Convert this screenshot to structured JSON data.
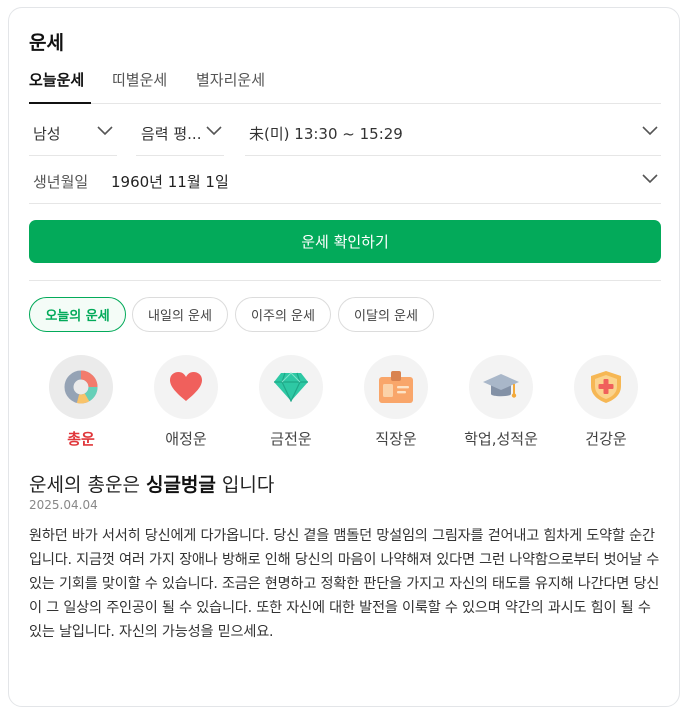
{
  "title": "운세",
  "tabs": [
    {
      "label": "오늘운세",
      "active": true
    },
    {
      "label": "띠별운세",
      "active": false
    },
    {
      "label": "별자리운세",
      "active": false
    }
  ],
  "form": {
    "gender": "남성",
    "calendar": "음력 평...",
    "birth_time": "未(미) 13:30 ~ 15:29",
    "birthdate_label": "생년월일",
    "birthdate_value": "1960년 11월 1일"
  },
  "confirm_button": "운세 확인하기",
  "period_chips": [
    {
      "label": "오늘의 운세",
      "active": true
    },
    {
      "label": "내일의 운세",
      "active": false
    },
    {
      "label": "이주의 운세",
      "active": false
    },
    {
      "label": "이달의 운세",
      "active": false
    }
  ],
  "categories": [
    {
      "label": "총운",
      "icon": "donut-chart-icon",
      "active": true
    },
    {
      "label": "애정운",
      "icon": "heart-icon",
      "active": false
    },
    {
      "label": "금전운",
      "icon": "diamond-icon",
      "active": false
    },
    {
      "label": "직장운",
      "icon": "id-badge-icon",
      "active": false
    },
    {
      "label": "학업,성적운",
      "icon": "graduation-cap-icon",
      "active": false
    },
    {
      "label": "건강운",
      "icon": "health-shield-icon",
      "active": false
    }
  ],
  "result": {
    "prefix": "운세의 총운은 ",
    "keyword": "싱글벙글",
    "suffix": " 입니다",
    "date": "2025.04.04",
    "body": "원하던 바가 서서히 당신에게 다가옵니다. 당신 곁을 맴돌던 망설임의 그림자를 걷어내고 힘차게 도약할 순간입니다. 지금껏 여러 가지 장애나 방해로 인해 당신의 마음이 나약해져 있다면 그런 나약함으로부터 벗어날 수 있는 기회를 맞이할 수 있습니다. 조금은 현명하고 정확한 판단을 가지고 자신의 태도를 유지해 나간다면 당신이 그 일상의 주인공이 될 수 있습니다. 또한 자신에 대한 발전을 이룩할 수 있으며 약간의 과시도 힘이 될 수 있는 날입니다. 자신의 가능성을 믿으세요."
  },
  "colors": {
    "accent_green": "#03aa5a",
    "active_category_red": "#e0373b"
  }
}
